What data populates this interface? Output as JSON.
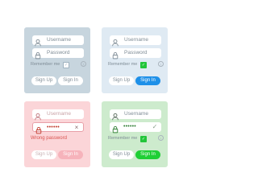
{
  "panels": [
    {
      "state": "default",
      "username_placeholder": "Username",
      "password_placeholder": "Password",
      "remember_label": "Remember me",
      "remember_checked": false,
      "signup_label": "Sign Up",
      "signin_label": "Sign In",
      "bg_color": "#c7d5de"
    },
    {
      "state": "ready",
      "username_placeholder": "Username",
      "password_placeholder": "Password",
      "remember_label": "Remember me",
      "remember_checked": true,
      "signup_label": "Sign Up",
      "signin_label": "Sign In",
      "bg_color": "#dfeaf3",
      "signin_color": "#1e90e8"
    },
    {
      "state": "error",
      "username_placeholder": "Username",
      "password_value": "••••••",
      "error_text": "Wrong password",
      "signup_label": "Sign Up",
      "signin_label": "Sign In",
      "bg_color": "#fbd5d8",
      "error_color": "#d9534f"
    },
    {
      "state": "success",
      "username_placeholder": "Username",
      "password_value": "••••••",
      "remember_label": "Remember me",
      "remember_checked": true,
      "signup_label": "Sign Up",
      "signin_label": "Sign In",
      "bg_color": "#cdebcd",
      "signin_color": "#1fcf35"
    }
  ],
  "icons": {
    "user": "user-icon",
    "lock": "lock-icon",
    "info": "info-icon",
    "clear": "close-icon",
    "valid": "checkmark-icon"
  }
}
